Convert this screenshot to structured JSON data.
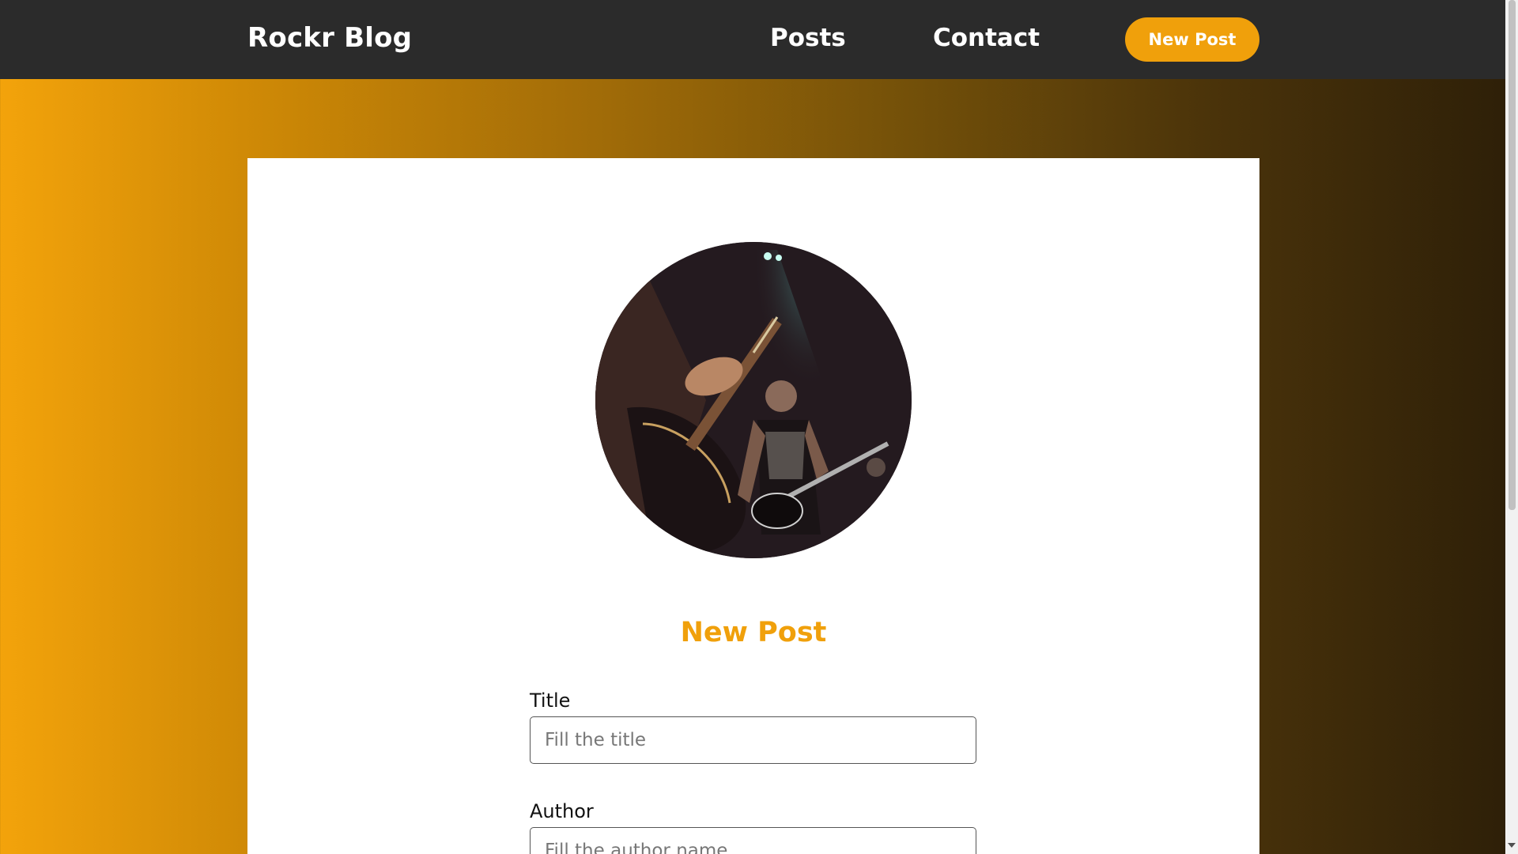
{
  "navbar": {
    "brand": "Rockr Blog",
    "links": [
      {
        "label": "Posts"
      },
      {
        "label": "Contact"
      }
    ],
    "cta_label": "New Post"
  },
  "card": {
    "title": "New Post",
    "fields": {
      "title": {
        "label": "Title",
        "placeholder": "Fill the title",
        "value": ""
      },
      "author": {
        "label": "Author",
        "placeholder": "Fill the author name",
        "value": ""
      }
    }
  },
  "colors": {
    "accent": "#f0a00b",
    "navbar_bg": "#2b2b2b",
    "card_bg": "#ffffff"
  },
  "icons": [
    "scroll-down-arrow-icon"
  ]
}
